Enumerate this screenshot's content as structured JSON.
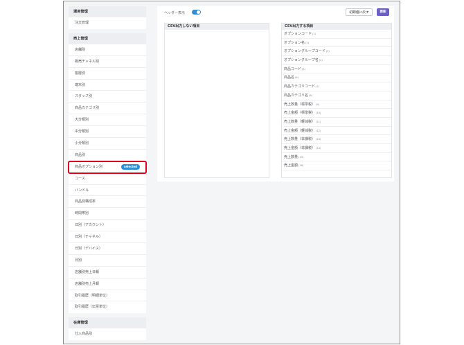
{
  "sidebar": {
    "groups": [
      {
        "header": "運用管理",
        "items": [
          {
            "label": "注文管理"
          }
        ]
      },
      {
        "header": "売上管理",
        "items": [
          {
            "label": "店舗別"
          },
          {
            "label": "販売チャネル別"
          },
          {
            "label": "客層別"
          },
          {
            "label": "端末別"
          },
          {
            "label": "スタッフ別"
          },
          {
            "label": "商品カテゴリ別"
          },
          {
            "label": "大分類別"
          },
          {
            "label": "中分類別"
          },
          {
            "label": "小分類別"
          },
          {
            "label": "商品別"
          },
          {
            "label": "商品オプション別",
            "badge": "selected"
          },
          {
            "label": "コース"
          },
          {
            "label": "バンドル"
          },
          {
            "label": "商品別構成率"
          },
          {
            "label": "時間帯別"
          },
          {
            "label": "日別（アカウント）"
          },
          {
            "label": "日別（チャネル）"
          },
          {
            "label": "日別（デバイス）"
          },
          {
            "label": "月別"
          },
          {
            "label": "店舗別売上日報"
          },
          {
            "label": "店舗別売上月報"
          },
          {
            "label": "取引履歴（明細単位）"
          },
          {
            "label": "取引履歴（伝票単位）"
          }
        ]
      },
      {
        "header": "在庫管理",
        "items": [
          {
            "label": "仕入商品別"
          }
        ]
      }
    ]
  },
  "main": {
    "toggle_label": "ヘッダー表示",
    "toggle_on": true,
    "reset_button": "初期値に戻す",
    "update_button": "更新",
    "left_panel_header": "CSV出力しない項目",
    "right_panel_header": "CSV出力する項目",
    "output_items": [
      {
        "label": "オプションコード",
        "num": "(1)"
      },
      {
        "label": "オプション名",
        "num": "(2)"
      },
      {
        "label": "オプショングループコード",
        "num": "(3)"
      },
      {
        "label": "オプショングループ名",
        "num": "(4)"
      },
      {
        "label": "商品コード",
        "num": "(5)"
      },
      {
        "label": "商品名",
        "num": "(6)"
      },
      {
        "label": "商品カテゴリコード",
        "num": "(7)"
      },
      {
        "label": "商品カテゴリ名",
        "num": "(8)"
      },
      {
        "label": "売上数量（標準税）",
        "num": "(9)"
      },
      {
        "label": "売上金額（標準税）",
        "num": "(10)"
      },
      {
        "label": "売上数量（軽減税）",
        "num": "(11)"
      },
      {
        "label": "売上金額（軽減税）",
        "num": "(12)"
      },
      {
        "label": "売上数量（非課税）",
        "num": "(13)"
      },
      {
        "label": "売上金額（非課税）",
        "num": "(14)"
      },
      {
        "label": "売上数量",
        "num": "(15)"
      },
      {
        "label": "売上金額",
        "num": "(16)"
      }
    ]
  },
  "colors": {
    "accent": "#2d8fd8",
    "primary_button": "#6b5fc7",
    "highlight": "#e0001a"
  }
}
